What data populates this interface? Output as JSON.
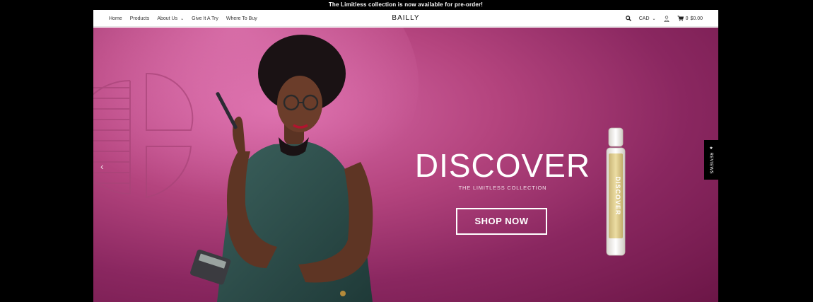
{
  "announcement": "The Limitless collection is now available for pre-order!",
  "brand": "BAILLY",
  "nav": {
    "items": [
      "Home",
      "Products",
      "About Us",
      "Give It A Try",
      "Where To Buy"
    ]
  },
  "utility": {
    "currency": "CAD",
    "cart_count": "0",
    "cart_total": "$0.00"
  },
  "hero": {
    "headline": "DISCOVER",
    "subheadline": "THE LIMITLESS COLLECTION",
    "cta": "SHOP NOW",
    "bottle_label": "DISCOVER",
    "prev_arrow": "‹"
  },
  "reviews_tab": "★ REVIEWS",
  "colors": {
    "hero_magenta": "#b4447e",
    "hero_dark": "#6c1647",
    "dress_teal": "#2f4f4c"
  }
}
